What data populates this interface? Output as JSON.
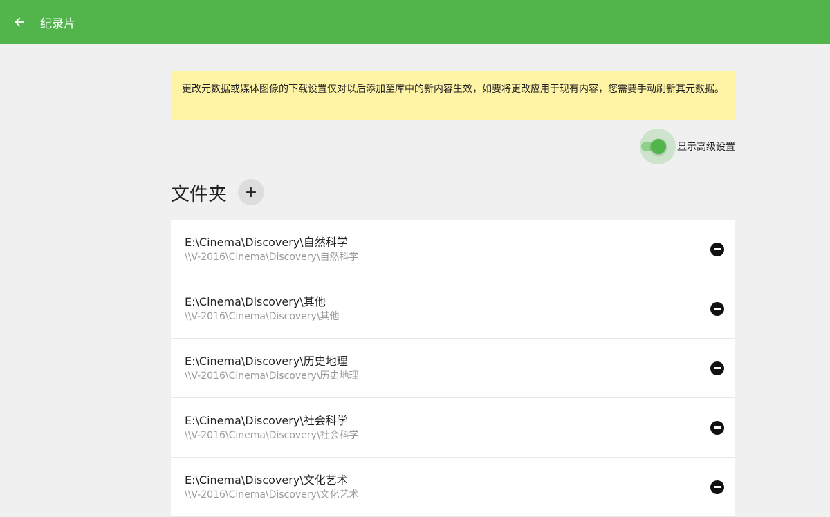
{
  "header": {
    "title": "纪录片",
    "back_icon": "arrow-left-icon"
  },
  "notice": "更改元数据或媒体图像的下载设置仅对以后添加至库中的新内容生效，如要将更改应用于现有内容，您需要手动刷新其元数据。",
  "advanced": {
    "label": "显示高级设置",
    "on": true
  },
  "folders": {
    "title": "文件夹",
    "add_label": "+",
    "items": [
      {
        "path": "E:\\Cinema\\Discovery\\自然科学",
        "network": "\\\\V-2016\\Cinema\\Discovery\\自然科学"
      },
      {
        "path": "E:\\Cinema\\Discovery\\其他",
        "network": "\\\\V-2016\\Cinema\\Discovery\\其他"
      },
      {
        "path": "E:\\Cinema\\Discovery\\历史地理",
        "network": "\\\\V-2016\\Cinema\\Discovery\\历史地理"
      },
      {
        "path": "E:\\Cinema\\Discovery\\社会科学",
        "network": "\\\\V-2016\\Cinema\\Discovery\\社会科学"
      },
      {
        "path": "E:\\Cinema\\Discovery\\文化艺术",
        "network": "\\\\V-2016\\Cinema\\Discovery\\文化艺术"
      }
    ]
  }
}
